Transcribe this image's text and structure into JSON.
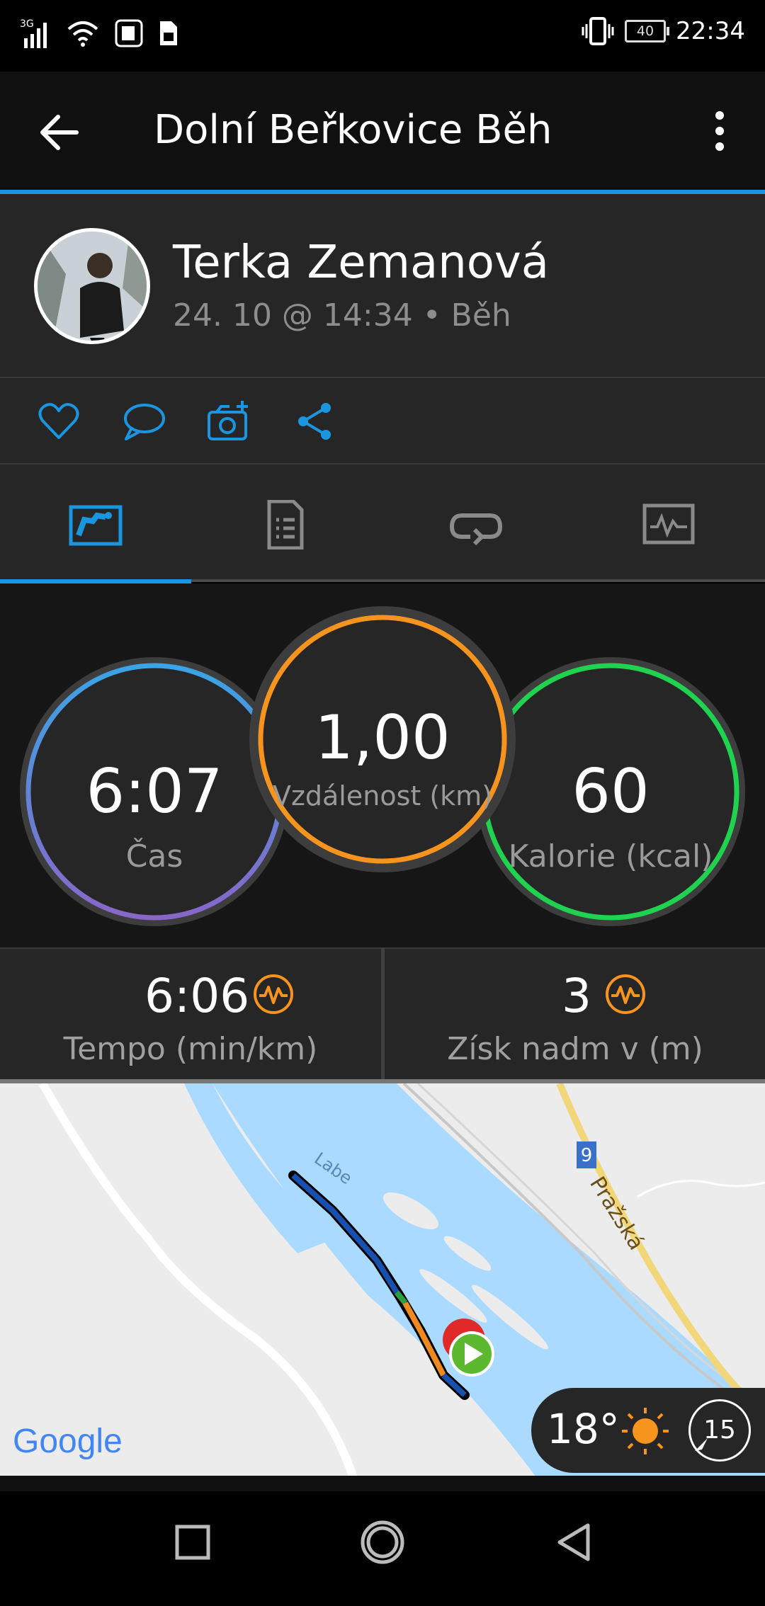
{
  "status_bar": {
    "network": "3G",
    "battery": "40",
    "time": "22:34"
  },
  "app_bar": {
    "title": "Dolní Beřkovice Běh"
  },
  "profile": {
    "name": "Terka Zemanová",
    "meta": "24. 10 @ 14:34 • Běh"
  },
  "actions": [
    "like-icon",
    "comment-icon",
    "add-photo-icon",
    "share-icon"
  ],
  "tabs": [
    {
      "icon": "overview-icon",
      "selected": true
    },
    {
      "icon": "details-icon",
      "selected": false
    },
    {
      "icon": "laps-icon",
      "selected": false
    },
    {
      "icon": "charts-icon",
      "selected": false
    }
  ],
  "summary": {
    "time": {
      "value": "6:07",
      "label": "Čas"
    },
    "distance": {
      "value": "1,00",
      "label": "Vzdálenost (km)"
    },
    "calories": {
      "value": "60",
      "label": "Kalorie (kcal)"
    }
  },
  "stats": {
    "pace": {
      "value": "6:06",
      "label": "Tempo (min/km)"
    },
    "elevation": {
      "value": "3",
      "label": "Získ nadm v (m)"
    }
  },
  "map": {
    "river_label": "Labe",
    "road_label": "Pražská",
    "road_number": "9",
    "attribution": "Google"
  },
  "weather": {
    "temperature": "18°",
    "wind": "15"
  },
  "colors": {
    "accent": "#1a96e0",
    "time_ring": "#4a9be0",
    "distance_ring": "#f7941d",
    "calorie_ring": "#1fd24f",
    "activity_icon": "#f7941d"
  }
}
